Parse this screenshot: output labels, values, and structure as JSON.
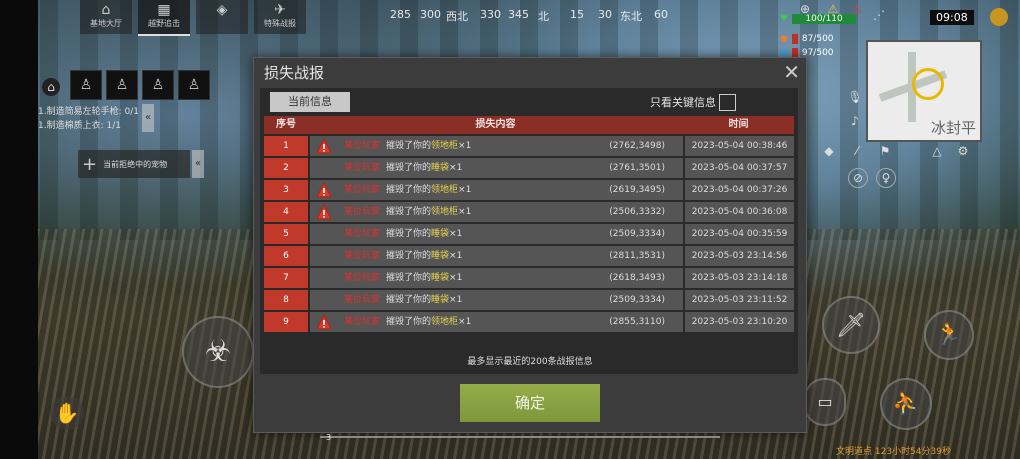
{
  "compass": [
    "285",
    "300",
    "西北",
    "330",
    "345",
    "北",
    "15",
    "30",
    "东北",
    "60"
  ],
  "top_tabs": [
    {
      "label": "基地大厅",
      "icon": "home-icon"
    },
    {
      "label": "越野追击",
      "icon": "fence-icon"
    },
    {
      "label": "",
      "icon": "map-icon"
    },
    {
      "label": "特殊战报",
      "icon": "plane-icon"
    }
  ],
  "quests": [
    "1.制造简易左轮手枪: 0/1",
    "1.制造棉质上衣: 1/1"
  ],
  "left_button": "当前拒绝中的宠物",
  "hud": {
    "health": "100/110",
    "food": "87/500",
    "water": "97/500",
    "clock": "09:08",
    "map_label": "冰封平"
  },
  "dialog": {
    "title": "损失战报",
    "tab": "当前信息",
    "key_only_label": "只看关键信息",
    "columns": [
      "序号",
      "损失内容",
      "时间"
    ],
    "rows": [
      {
        "no": "1",
        "warn": true,
        "who": "某位玩家",
        "action": "摧毁了你的",
        "item": "领地柜",
        "qty": "×1",
        "coord": "(2762,3498)",
        "time": "2023-05-04 00:38:46"
      },
      {
        "no": "2",
        "warn": false,
        "who": "某位玩家",
        "action": "摧毁了你的",
        "item": "睡袋",
        "qty": "×1",
        "coord": "(2761,3501)",
        "time": "2023-05-04 00:37:57"
      },
      {
        "no": "3",
        "warn": true,
        "who": "某位玩家",
        "action": "摧毁了你的",
        "item": "领地柜",
        "qty": "×1",
        "coord": "(2619,3495)",
        "time": "2023-05-04 00:37:26"
      },
      {
        "no": "4",
        "warn": true,
        "who": "某位玩家",
        "action": "摧毁了你的",
        "item": "领地柜",
        "qty": "×1",
        "coord": "(2506,3332)",
        "time": "2023-05-04 00:36:08"
      },
      {
        "no": "5",
        "warn": false,
        "who": "某位玩家",
        "action": "摧毁了你的",
        "item": "睡袋",
        "qty": "×1",
        "coord": "(2509,3334)",
        "time": "2023-05-04 00:35:59"
      },
      {
        "no": "6",
        "warn": false,
        "who": "某位玩家",
        "action": "摧毁了你的",
        "item": "睡袋",
        "qty": "×1",
        "coord": "(2811,3531)",
        "time": "2023-05-03 23:14:56"
      },
      {
        "no": "7",
        "warn": false,
        "who": "某位玩家",
        "action": "摧毁了你的",
        "item": "睡袋",
        "qty": "×1",
        "coord": "(2618,3493)",
        "time": "2023-05-03 23:14:18"
      },
      {
        "no": "8",
        "warn": false,
        "who": "某位玩家",
        "action": "摧毁了你的",
        "item": "睡袋",
        "qty": "×1",
        "coord": "(2509,3334)",
        "time": "2023-05-03 23:11:52"
      },
      {
        "no": "9",
        "warn": true,
        "who": "某位玩家",
        "action": "摧毁了你的",
        "item": "领地柜",
        "qty": "×1",
        "coord": "(2855,3110)",
        "time": "2023-05-03 23:10:20"
      }
    ],
    "footnote": "最多显示最近的200条战报信息",
    "confirm": "确定"
  },
  "bottom": {
    "slot_number": "3",
    "status": "文明道点 123小时54分39秒"
  }
}
